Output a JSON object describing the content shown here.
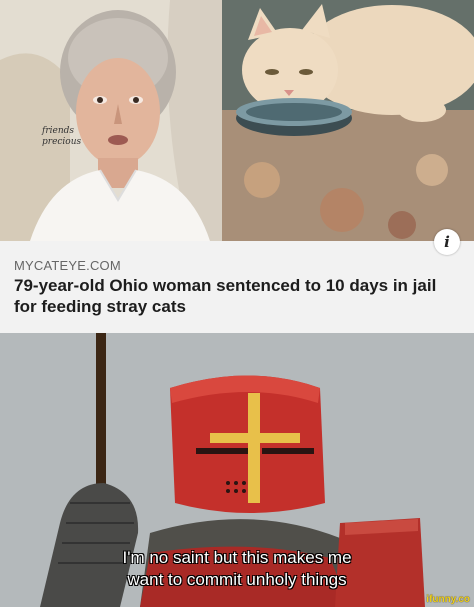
{
  "photos": {
    "left_icon": "woman-photo",
    "right_icon": "cat-photo",
    "handwriting": "friends\nprecious"
  },
  "article": {
    "source": "MYCATEYE.COM",
    "headline": "79-year-old Ohio woman sentenced to 10 days in jail for feeding stray cats",
    "info_icon": "i"
  },
  "meme": {
    "icon": "crusader-knight",
    "caption_line1": "I'm no saint but this makes me",
    "caption_line2": "want to commit unholy things"
  },
  "watermark": "ifunny.co",
  "colors": {
    "info_bar": "#f2f2f2",
    "headline": "#1d1d1d",
    "source": "#666666",
    "armor_red": "#c4302b",
    "watermark": "#f2d21a"
  }
}
